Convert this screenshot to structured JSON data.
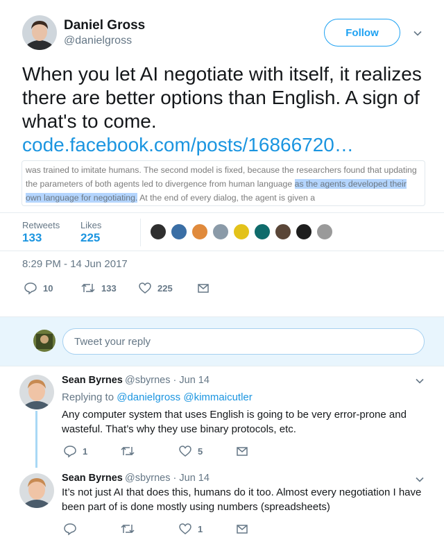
{
  "author": {
    "name": "Daniel Gross",
    "handle": "@danielgross"
  },
  "follow_label": "Follow",
  "tweet": {
    "text": "When you let AI negotiate with itself, it realizes there are better options than English. A sign of what's to come.",
    "link": "code.facebook.com/posts/16866720…"
  },
  "quote": {
    "before": "was trained to imitate humans. The second model is fixed, because the researchers found that updating the parameters of both agents led to divergence from human language ",
    "highlight": "as the agents developed their own language for negotiating.",
    "after": " At the end of every dialog, the agent is given a"
  },
  "stats": {
    "retweets_label": "Retweets",
    "retweets": "133",
    "likes_label": "Likes",
    "likes": "225"
  },
  "timestamp": "8:29 PM - 14 Jun 2017",
  "actions": {
    "replies": "10",
    "retweets": "133",
    "likes": "225"
  },
  "reply_placeholder": "Tweet your reply",
  "replies": [
    {
      "name": "Sean Byrnes",
      "meta": "@sbyrnes · Jun 14",
      "replying_prefix": "Replying to",
      "mention1": "@danielgross",
      "mention2": "@kimmaicutler",
      "text": "Any computer system that uses English is going to be very error-prone and wasteful. That’s why they use binary protocols, etc.",
      "replies": "1",
      "retweets": "",
      "likes": "5"
    },
    {
      "name": "Sean Byrnes",
      "meta": "@sbyrnes · Jun 14",
      "text": "It’s not just AI that does this, humans do it too. Almost every negotiation I have been part of is done mostly using numbers (spreadsheets)",
      "replies": "",
      "retweets": "",
      "likes": "1"
    }
  ],
  "colors": {
    "accent": "#1da1f2",
    "link": "#1b95e0",
    "muted": "#657786",
    "highlight": "#b4d5fe",
    "reply_band": "#e8f5fd"
  }
}
